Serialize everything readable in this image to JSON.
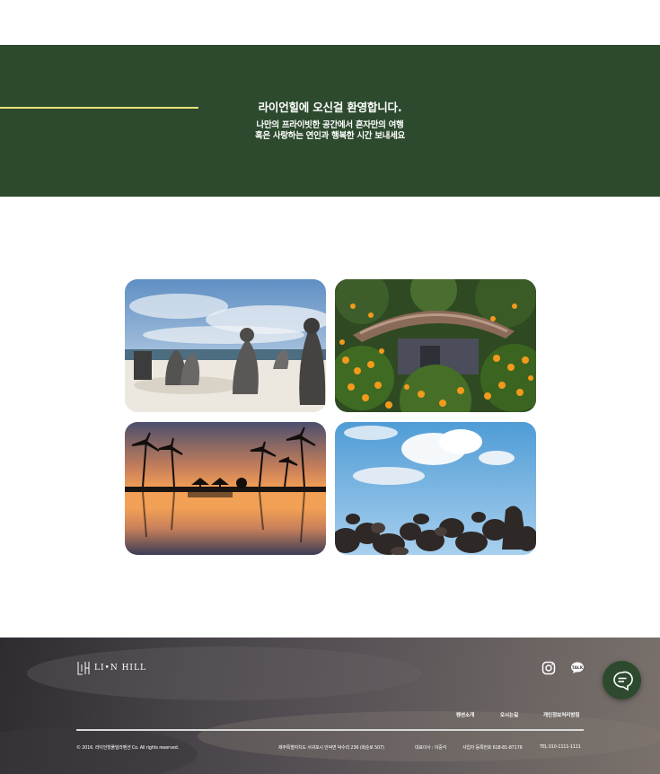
{
  "banner": {
    "title": "라이언힐에 오신걸 환영합니다.",
    "subtitle_line1": "나만의 프라이빗한 공간에서 혼자만의 여행",
    "subtitle_line2": "혹은 사랑하는 연인과 행복한 시간 보내세요",
    "background_color": "#2d4a2e",
    "line_color": "#e8e07a"
  },
  "gallery": {
    "photos": [
      {
        "subject": "dol-hareubang stone statues on a beach"
      },
      {
        "subject": "thatched-roof house behind tangerine trees"
      },
      {
        "subject": "palm trees silhouetted at sunset reflected in a pool"
      },
      {
        "subject": "black volcanic rocks under a blue sky"
      }
    ]
  },
  "footer": {
    "logo_text": "LI•N HILL",
    "icons": {
      "instagram": "instagram-icon",
      "kakao": "kakao-talk-icon",
      "chat": "chat-bubble-icon"
    },
    "nav": [
      "펜션소개",
      "오시는길",
      "개인정보처리방침"
    ],
    "copyright": "© 2016. 라이언힐풀빌라펜션 Co. All rights reserved.",
    "address": "제주특별자치도 서귀포시 안덕면 덕수리 236 (화순로 507)",
    "ceo": "대표이사 : 이중석",
    "business_no": "사업자 등록번호 618-81-87176",
    "tel": "TEL 010-1111-1111"
  }
}
